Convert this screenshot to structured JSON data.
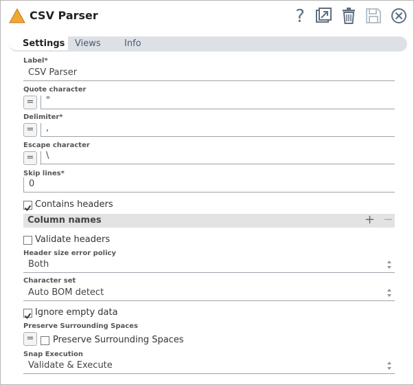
{
  "header": {
    "title": "CSV Parser",
    "icons": [
      "warning-triangle-icon",
      "help-icon",
      "export-icon",
      "delete-icon",
      "save-icon",
      "close-icon"
    ]
  },
  "tabs": [
    {
      "label": "Settings",
      "active": true
    },
    {
      "label": "Views",
      "active": false
    },
    {
      "label": "Info",
      "active": false
    }
  ],
  "fields": {
    "label": {
      "label": "Label*",
      "value": "CSV Parser"
    },
    "quote": {
      "label": "Quote character",
      "value": "\""
    },
    "delimiter": {
      "label": "Delimiter*",
      "value": ","
    },
    "escape": {
      "label": "Escape character",
      "value": "\\"
    },
    "skip_lines": {
      "label": "Skip lines*",
      "value": "0"
    },
    "contains_headers": {
      "label": "Contains headers",
      "checked": true
    },
    "column_names": {
      "label": "Column names"
    },
    "validate_headers": {
      "label": "Validate headers",
      "checked": false
    },
    "header_size_policy": {
      "label": "Header size error policy",
      "value": "Both"
    },
    "charset": {
      "label": "Character set",
      "value": "Auto BOM detect"
    },
    "ignore_empty": {
      "label": "Ignore empty data",
      "checked": true
    },
    "preserve_spaces": {
      "label": "Preserve Surrounding Spaces",
      "checkbox_label": "Preserve Surrounding Spaces",
      "checked": false
    },
    "snap_execution": {
      "label": "Snap Execution",
      "value": "Validate & Execute"
    }
  },
  "expr_button_label": "=",
  "colors": {
    "accent_orange": "#f0a020",
    "tab_bg": "#dde1e6"
  }
}
